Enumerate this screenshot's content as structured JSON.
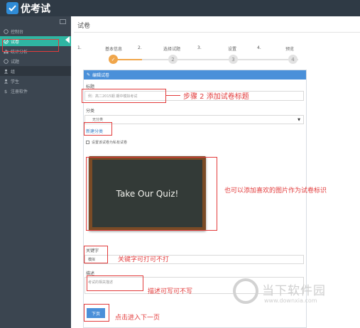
{
  "app": {
    "title": "优考试"
  },
  "sidebar": {
    "items": [
      {
        "label": "控制台"
      },
      {
        "label": "试卷"
      },
      {
        "label": "统计分析"
      },
      {
        "label": "试题"
      },
      {
        "label": "组"
      },
      {
        "label": "学生"
      },
      {
        "label": "注册软件"
      }
    ]
  },
  "page": {
    "title": "试卷"
  },
  "steps": [
    {
      "num": "1.",
      "label": "基本信息",
      "dot": "✓"
    },
    {
      "num": "2.",
      "label": "选择试题",
      "dot": "2"
    },
    {
      "num": "3.",
      "label": "设置",
      "dot": "3"
    },
    {
      "num": "4.",
      "label": "预览",
      "dot": "4"
    }
  ],
  "form": {
    "header": "编辑试卷",
    "title_label": "标题",
    "title_placeholder": "例：高二2015期 期中模拟考试",
    "category_label": "分类",
    "category_value": "无分类",
    "new_category": "新建分类",
    "private_checkbox": "设置该试卷为私有试卷",
    "image_text": "Take Our Quiz!",
    "keyword_label": "关键字",
    "keyword_value": "模拟",
    "desc_label": "描述",
    "desc_placeholder": "考试的相关描述",
    "next_button": "下页"
  },
  "annotations": {
    "step2": "步骤 2 添加试卷标题",
    "image": "也可以添加喜欢的图片作为试卷标识",
    "keyword": "关键字可打可不打",
    "desc": "描述可写可不写",
    "next": "点击进入下一页"
  },
  "watermark": {
    "text": "当下软件园",
    "url": "www.downxia.com"
  },
  "colors": {
    "accent": "#2fb6a2",
    "primary": "#4a90d9",
    "annotation": "#e23b3b",
    "step_active": "#f0a64b"
  }
}
